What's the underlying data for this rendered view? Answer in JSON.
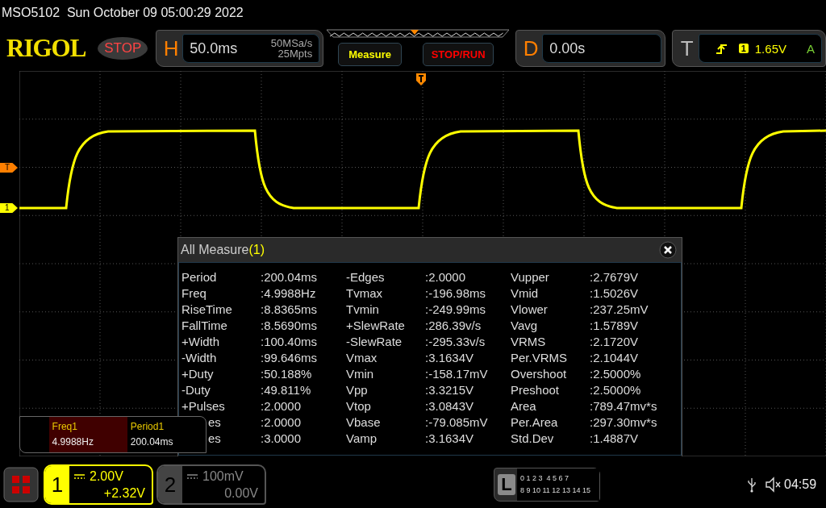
{
  "title_bar": {
    "text": "MSO5102  Sun October 09 05:00:29 2022"
  },
  "header": {
    "logo": "RIGOL",
    "run_state": "STOP",
    "horizontal": {
      "letter": "H",
      "timebase": "50.0ms",
      "sample_rate": "50MSa/s",
      "memory_depth": "25Mpts"
    },
    "buttons": [
      {
        "label": "Measure",
        "kind": "measure"
      },
      {
        "label": "STOP/RUN",
        "kind": "run"
      }
    ],
    "delay": {
      "letter": "D",
      "value": "0.00s"
    },
    "trigger": {
      "letter": "T",
      "source": "1",
      "level": "1.65V",
      "mode": "A"
    }
  },
  "markers": [
    {
      "label": "T",
      "kind": "trigger"
    },
    {
      "label": "1",
      "kind": "channel"
    }
  ],
  "measure_panel": {
    "title": "All Measure",
    "channel": "(1)",
    "columns": [
      [
        {
          "label": "Period",
          "value": ":200.04ms"
        },
        {
          "label": "Freq",
          "value": ":4.9988Hz"
        },
        {
          "label": "RiseTime",
          "value": ":8.8365ms"
        },
        {
          "label": "FallTime",
          "value": ":8.5690ms"
        },
        {
          "label": "+Width",
          "value": ":100.40ms"
        },
        {
          "label": "-Width",
          "value": ":99.646ms"
        },
        {
          "label": "+Duty",
          "value": ":50.188%"
        },
        {
          "label": "-Duty",
          "value": ":49.811%"
        },
        {
          "label": "+Pulses",
          "value": ":2.0000"
        },
        {
          "label": "es",
          "value": ":2.0000",
          "covered": true
        },
        {
          "label": "es",
          "value": ":3.0000",
          "covered": true
        }
      ],
      [
        {
          "label": "-Edges",
          "value": ":2.0000"
        },
        {
          "label": "Tvmax",
          "value": ":-196.98ms"
        },
        {
          "label": "Tvmin",
          "value": ":-249.99ms"
        },
        {
          "label": "+SlewRate",
          "value": ":286.39v/s"
        },
        {
          "label": "-SlewRate",
          "value": ":-295.33v/s"
        },
        {
          "label": "Vmax",
          "value": ":3.1634V"
        },
        {
          "label": "Vmin",
          "value": ":-158.17mV"
        },
        {
          "label": "Vpp",
          "value": ":3.3215V"
        },
        {
          "label": "Vtop",
          "value": ":3.0843V"
        },
        {
          "label": "Vbase",
          "value": ":-79.085mV"
        },
        {
          "label": "Vamp",
          "value": ":3.1634V"
        }
      ],
      [
        {
          "label": "Vupper",
          "value": ":2.7679V"
        },
        {
          "label": "Vmid",
          "value": ":1.5026V"
        },
        {
          "label": "Vlower",
          "value": ":237.25mV"
        },
        {
          "label": "Vavg",
          "value": ":1.5789V"
        },
        {
          "label": "VRMS",
          "value": ":2.1720V"
        },
        {
          "label": "Per.VRMS",
          "value": ":2.1044V"
        },
        {
          "label": "Overshoot",
          "value": ":2.5000%"
        },
        {
          "label": "Preshoot",
          "value": ":2.5000%"
        },
        {
          "label": "Area",
          "value": ":789.47mv*s"
        },
        {
          "label": "Per.Area",
          "value": ":297.30mv*s"
        },
        {
          "label": "Std.Dev",
          "value": ":1.4887V"
        }
      ]
    ]
  },
  "quick_measure": [
    {
      "label": "Freq1",
      "value": "4.9988Hz",
      "selected": true
    },
    {
      "label": "Period1",
      "value": "200.04ms",
      "selected": false
    }
  ],
  "channels": [
    {
      "number": "1",
      "scale": "2.00V",
      "offset": "+2.32V",
      "on": true
    },
    {
      "number": "2",
      "scale": "100mV",
      "offset": "0.00V",
      "on": false
    }
  ],
  "logic": {
    "letter": "L",
    "rows": [
      "0 1 2 3  4 5 6 7",
      "8 9 10 11 12 13 14 15"
    ]
  },
  "status": {
    "time": "04:59"
  }
}
